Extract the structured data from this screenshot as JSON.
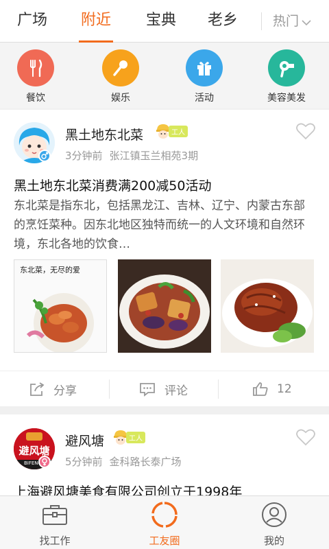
{
  "tabs": [
    {
      "label": "广场",
      "active": false
    },
    {
      "label": "附近",
      "active": true
    },
    {
      "label": "宝典",
      "active": false
    },
    {
      "label": "老乡",
      "active": false
    }
  ],
  "hot_filter": "热门",
  "categories": [
    {
      "label": "餐饮",
      "color": "#f06a55",
      "icon": "fork-knife-icon"
    },
    {
      "label": "娱乐",
      "color": "#f7a21c",
      "icon": "microphone-icon"
    },
    {
      "label": "活动",
      "color": "#3ba7ea",
      "icon": "gift-icon"
    },
    {
      "label": "美容美发",
      "color": "#27b79b",
      "icon": "hair-dryer-icon"
    }
  ],
  "posts": [
    {
      "author": "黑土地东北菜",
      "badge": "工人",
      "time": "3分钟前",
      "location": "张江镇玉兰相苑3期",
      "title": "黑土地东北菜消费满200减50活动",
      "body": "东北菜是指东北，包括黑龙江、吉林、辽宁、内蒙古东部的烹饪菜种。因东北地区独特而统一的人文环境和自然环境，东北各地的饮食…",
      "images": [
        {
          "caption": "东北菜，无尽的爱"
        },
        {
          "caption": ""
        },
        {
          "caption": ""
        }
      ],
      "share_label": "分享",
      "comment_label": "评论",
      "like_count": "12"
    },
    {
      "author": "避风塘",
      "badge": "工人",
      "time": "5分钟前",
      "location": "金科路长泰广场",
      "title": "上海避风塘美食有限公司创立于1998年",
      "avatar_text": "避风塘",
      "avatar_subtext": "BIFENGT"
    }
  ],
  "bottom_nav": [
    {
      "label": "找工作",
      "active": false,
      "icon": "briefcase-icon"
    },
    {
      "label": "工友圈",
      "active": true,
      "icon": "circle-ring-icon"
    },
    {
      "label": "我的",
      "active": false,
      "icon": "user-icon"
    }
  ],
  "colors": {
    "accent": "#f26b1d",
    "badge": "#d8e85c"
  }
}
